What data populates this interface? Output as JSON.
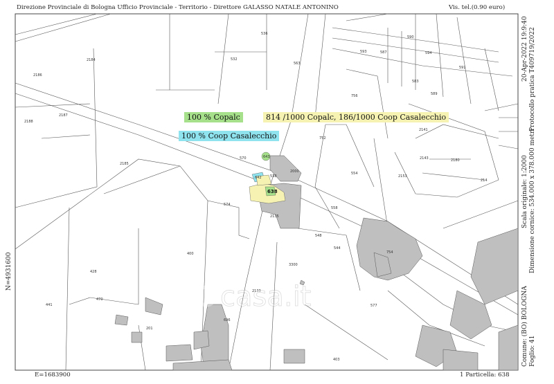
{
  "header": {
    "title": "Direzione Provinciale di Bologna  Ufficio Provinciale - Territorio - Direttore GALASSO NATALE ANTONINO",
    "cost": "Vis. tel.(0.90 euro)"
  },
  "right_margin": {
    "line1": "20-Apr-2022 19:9:40",
    "line2": "Protocollo pratica T409719/2022",
    "line3": "Scala originale: 1:2000",
    "line4": "Dimensione cornice: 534.000 x 378.000 metri",
    "comune": "Comune: (BO) BOLOGNA",
    "foglio": "Foglio: 41"
  },
  "left_margin": {
    "north": "N=4931600"
  },
  "footer": {
    "east": "E=1683900",
    "particella": "1 Particella: 638"
  },
  "legend": {
    "copalc": "100 % Copalc",
    "mixed": "814 /1000 Copalc, 186/1000 Coop Casalecchio",
    "coop": "100 % Coop Casalecchio"
  },
  "colors": {
    "copalc": "#a6e08a",
    "mixed": "#f6f3b2",
    "coop": "#8fe3ef"
  },
  "watermark": "casa.it",
  "parcels": {
    "p536": "536",
    "p532": "532",
    "p563": "563",
    "p2184": "2184",
    "p2186": "2186",
    "p2187": "2187",
    "p2188": "2188",
    "p2185": "2185",
    "p570": "570",
    "p574": "574",
    "p2135": "2135",
    "p400": "400",
    "p428": "428",
    "p3300": "3300",
    "p577": "577",
    "p403": "403",
    "p754": "754",
    "p558": "558",
    "p548": "548",
    "p544": "544",
    "p554": "554",
    "p752": "752",
    "p756": "756",
    "p2141": "2141",
    "p2180": "2180",
    "p2143": "2143",
    "p2153": "2153",
    "p214": "214",
    "p538": "538",
    "p643": "643",
    "p642": "642",
    "p638": "638",
    "p2000": "2000",
    "p696": "696",
    "p201": "201",
    "p470": "470",
    "p441": "441",
    "p594": "594",
    "p589": "589",
    "p590": "590",
    "p587": "587",
    "p593": "593",
    "p583": "583",
    "p591": "591",
    "p2133": "2133"
  }
}
